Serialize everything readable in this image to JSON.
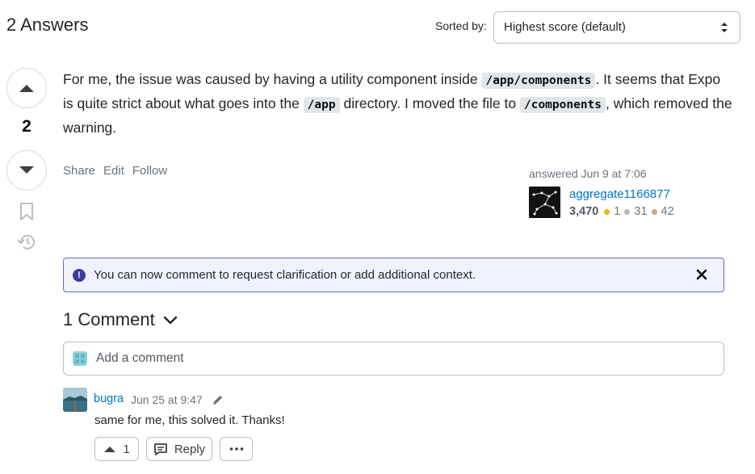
{
  "header": {
    "answers_title": "2 Answers",
    "sort_label": "Sorted by:",
    "sort_value": "Highest score (default)"
  },
  "answer": {
    "score": "2",
    "body": {
      "t1": "For me, the issue was caused by having a utility component inside ",
      "code1": "/app/components",
      "t2": ". It seems that Expo is quite strict about what goes into the ",
      "code2": "/app",
      "t3": " directory. I moved the file to ",
      "code3": "/components",
      "t4": ", which removed the warning."
    },
    "menu": {
      "share": "Share",
      "edit": "Edit",
      "follow": "Follow"
    },
    "answered": "answered Jun 9 at 7:06",
    "user": {
      "name": "aggregate1166877",
      "reputation": "3,470",
      "gold": "1",
      "silver": "31",
      "bronze": "42"
    }
  },
  "notice": {
    "text": "You can now comment to request clarification or add additional context."
  },
  "comments": {
    "toggle_label": "1 Comment",
    "add_placeholder": "Add a comment",
    "items": [
      {
        "user": "bugra",
        "date": "Jun 25 at 9:47",
        "text": "same for me, this solved it. Thanks!",
        "upvotes": "1",
        "reply_label": "Reply"
      }
    ]
  },
  "colors": {
    "link": "#0074cc",
    "notice_border": "#6a69c9",
    "notice_bg": "#f0f2ff"
  },
  "icons": [
    "sort-arrows-icon",
    "arrow-up-icon",
    "arrow-down-icon",
    "bookmark-icon",
    "history-icon",
    "info-icon",
    "close-icon",
    "chevron-down-icon",
    "comment-avatar-icon",
    "pencil-icon",
    "reply-icon",
    "more-icon"
  ]
}
